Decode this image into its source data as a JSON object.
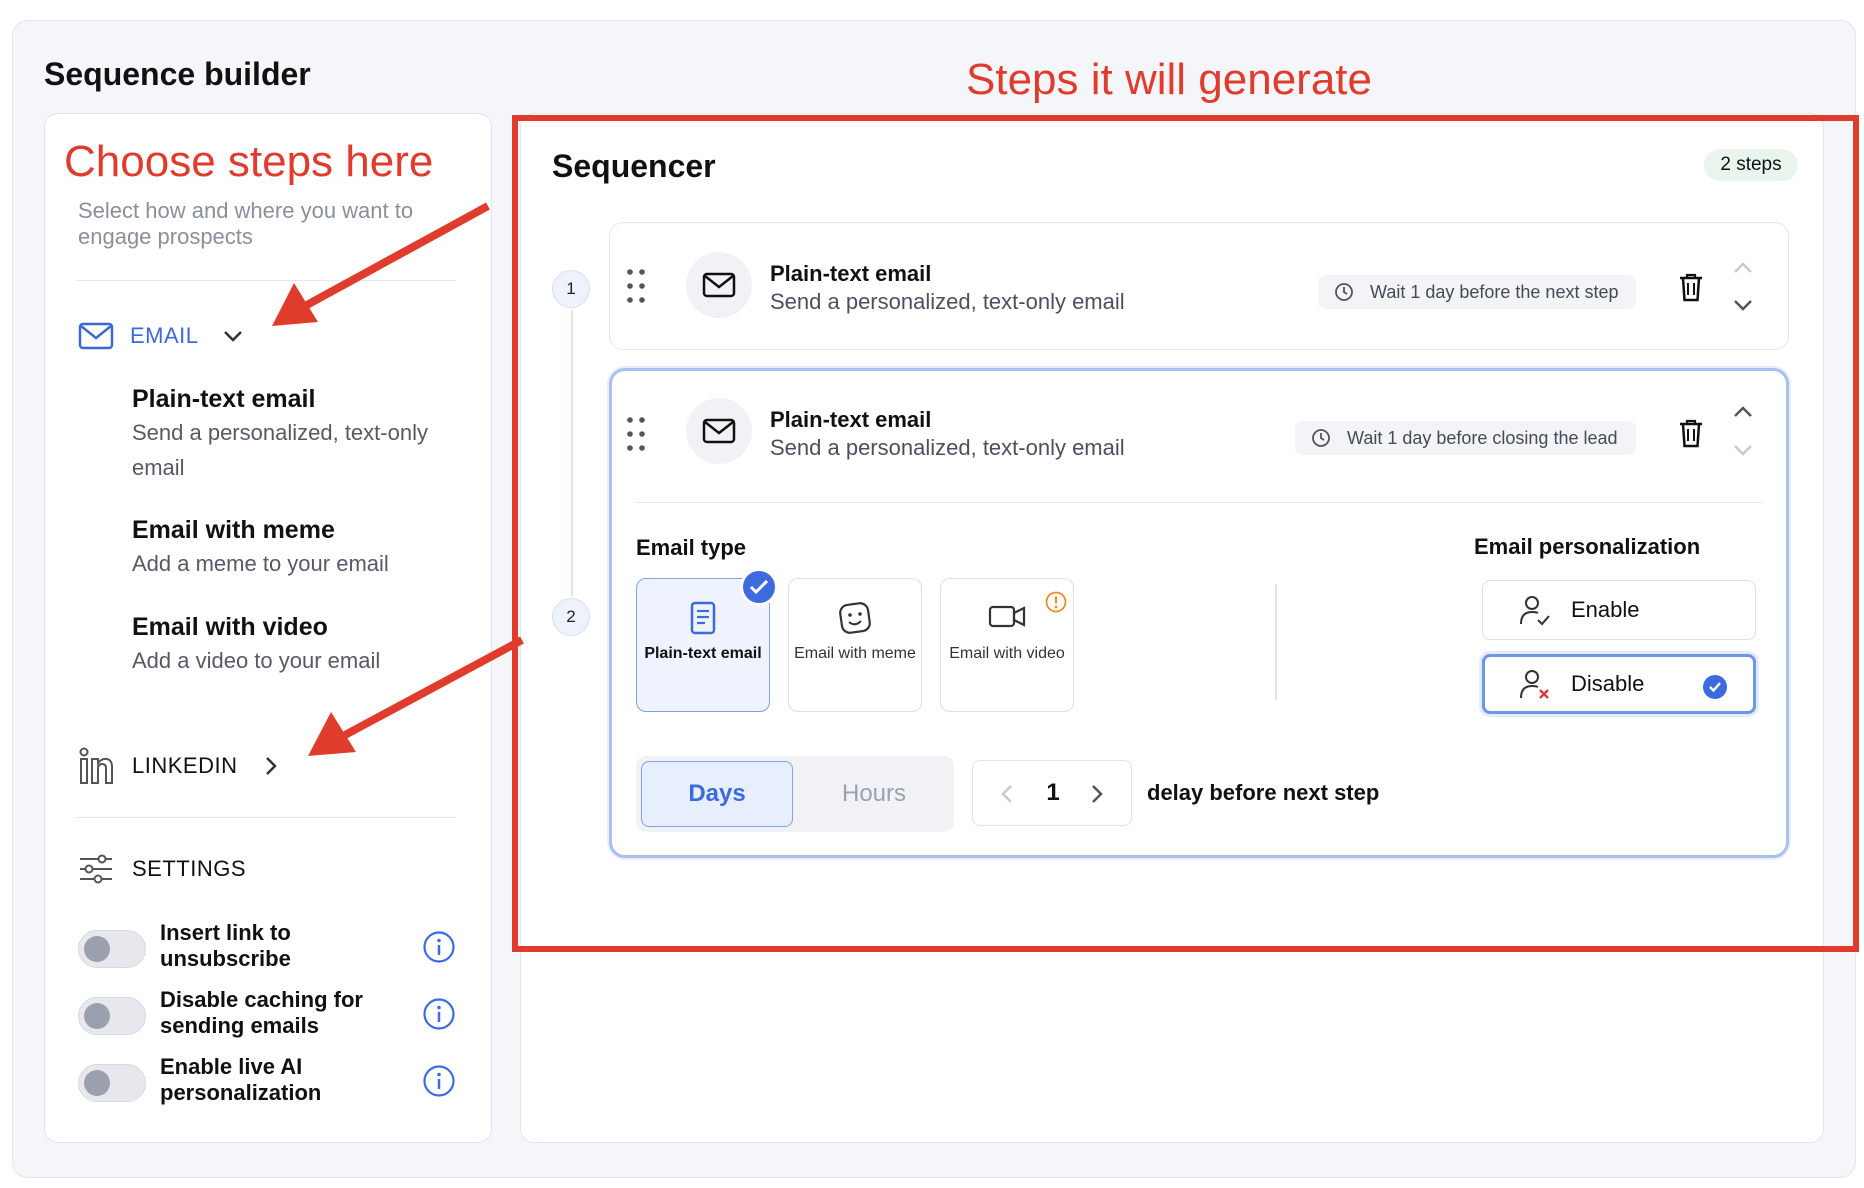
{
  "annotations": {
    "left": "Choose steps here",
    "right": "Steps it will generate"
  },
  "app": {
    "title": "Sequence builder"
  },
  "left_panel": {
    "subtitle": "Select how and where you want to engage prospects",
    "email_section": {
      "label": "EMAIL",
      "options": [
        {
          "title": "Plain-text email",
          "desc": "Send a personalized, text-only email"
        },
        {
          "title": "Email with meme",
          "desc": "Add a meme to your email"
        },
        {
          "title": "Email with video",
          "desc": "Add a video to your email"
        }
      ]
    },
    "linkedin_label": "LINKEDIN",
    "settings_label": "SETTINGS",
    "settings": [
      {
        "label": "Insert link to unsubscribe",
        "enabled": false
      },
      {
        "label": "Disable caching for sending emails",
        "enabled": false
      },
      {
        "label": "Enable live AI personalization",
        "enabled": false
      }
    ]
  },
  "sequencer": {
    "title": "Sequencer",
    "badge": "2 steps",
    "steps": [
      {
        "number": "1",
        "title": "Plain-text email",
        "desc": "Send a personalized, text-only email",
        "wait": "Wait 1 day before the next step"
      },
      {
        "number": "2",
        "title": "Plain-text email",
        "desc": "Send a personalized, text-only email",
        "wait": "Wait 1 day before closing the lead"
      }
    ],
    "editor": {
      "email_type_label": "Email type",
      "types": [
        {
          "label": "Plain-text email",
          "selected": true
        },
        {
          "label": "Email with meme",
          "selected": false
        },
        {
          "label": "Email with video",
          "selected": false
        }
      ],
      "personalization_label": "Email personalization",
      "personalization": [
        {
          "label": "Enable",
          "selected": false
        },
        {
          "label": "Disable",
          "selected": true
        }
      ],
      "unit_days": "Days",
      "unit_hours": "Hours",
      "selected_unit": "Days",
      "delay_value": "1",
      "delay_label": "delay before next step"
    }
  },
  "colors": {
    "accent": "#3c6be0",
    "annotation": "#e03c2d",
    "warning": "#f08a24"
  },
  "icons": [
    "envelope-icon",
    "chevron-down-icon",
    "chevron-right-icon",
    "linkedin-icon",
    "sliders-icon",
    "info-icon",
    "drag-handle-icon",
    "clock-icon",
    "trash-icon",
    "chevron-up-icon",
    "document-icon",
    "meme-icon",
    "video-icon",
    "warning-icon",
    "user-check-icon",
    "user-x-icon",
    "check-icon"
  ]
}
